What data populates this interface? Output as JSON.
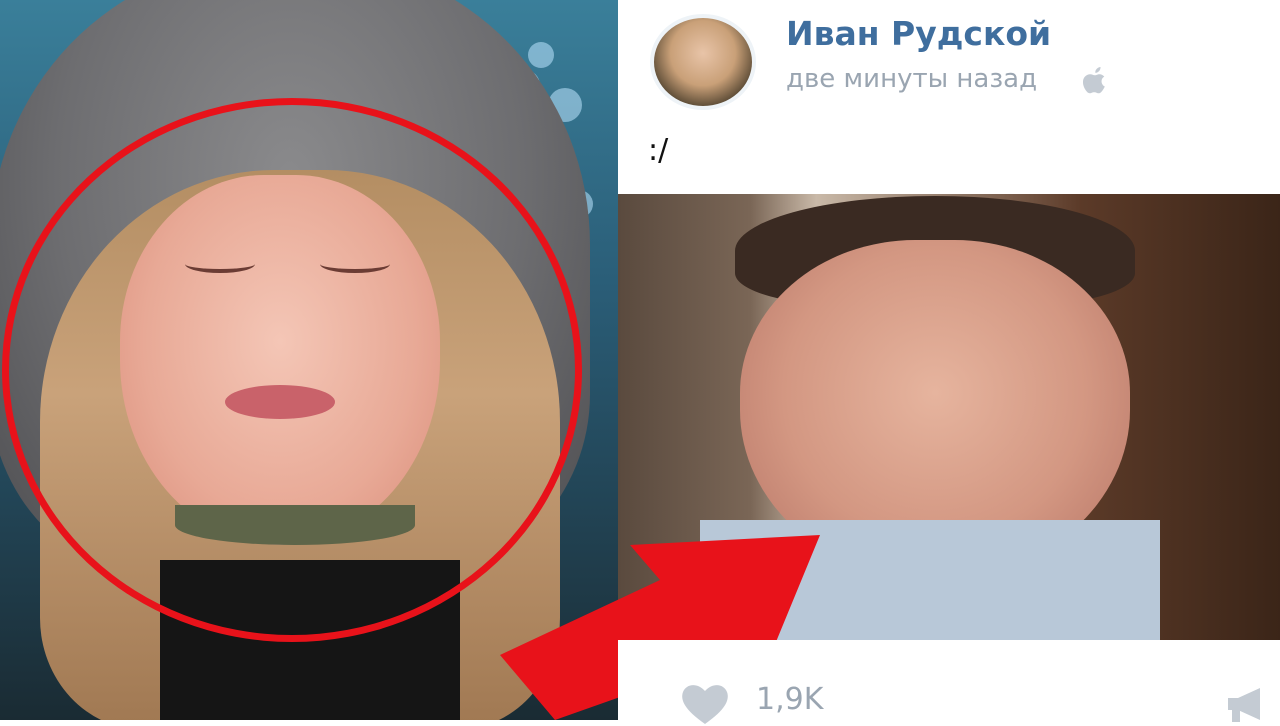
{
  "post": {
    "author": "Иван Рудской",
    "time": "две минуты назад",
    "text": ":/",
    "likes": "1,9K"
  },
  "icons": {
    "platform": "apple-icon",
    "like": "heart-icon",
    "share": "megaphone-icon"
  },
  "colors": {
    "highlight": "#e8121a",
    "author": "#3f6e9e",
    "meta": "#9aa5b1"
  }
}
